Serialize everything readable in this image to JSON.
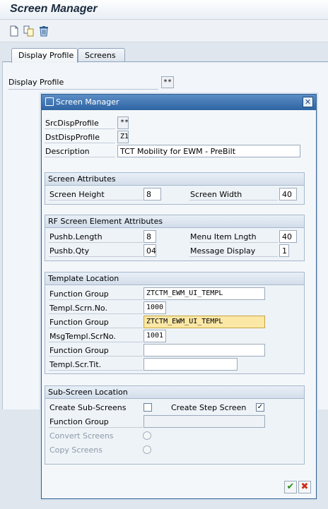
{
  "window": {
    "title": "Screen Manager"
  },
  "toolbar": {
    "icons": [
      "new-icon",
      "copy-icon",
      "delete-icon"
    ]
  },
  "tabs": [
    {
      "label": "Display Profile",
      "active": true
    },
    {
      "label": "Screens",
      "active": false
    }
  ],
  "main": {
    "display_profile_label": "Display Profile",
    "display_profile_value": "**"
  },
  "dialog": {
    "title": "Screen Manager",
    "close_label": "✕",
    "src_disp_profile": {
      "label": "SrcDispProfile",
      "value": "**"
    },
    "dst_disp_profile": {
      "label": "DstDispProfile",
      "value": "Z1"
    },
    "description": {
      "label": "Description",
      "value": "TCT Mobility for EWM - PreBilt"
    },
    "screen_attributes": {
      "title": "Screen Attributes",
      "screen_height": {
        "label": "Screen Height",
        "value": "8"
      },
      "screen_width": {
        "label": "Screen Width",
        "value": "40"
      }
    },
    "rf_attributes": {
      "title": "RF Screen Element Attributes",
      "pushb_length": {
        "label": "Pushb.Length",
        "value": "8"
      },
      "menu_item_length": {
        "label": "Menu Item Lngth",
        "value": "40"
      },
      "pushb_qty": {
        "label": "Pushb.Qty",
        "value": "04"
      },
      "message_display": {
        "label": "Message Display",
        "value": "1"
      }
    },
    "template_location": {
      "title": "Template Location",
      "function_group_1": {
        "label": "Function Group",
        "value": "ZTCTM_EWM_UI_TEMPL"
      },
      "templ_scrn_no": {
        "label": "Templ.Scrn.No.",
        "value": "1000"
      },
      "function_group_2": {
        "label": "Function Group",
        "value": "ZTCTM_EWM_UI_TEMPL"
      },
      "msg_templ_scrno": {
        "label": "MsgTempl.ScrNo.",
        "value": "1001"
      },
      "function_group_3": {
        "label": "Function Group",
        "value": ""
      },
      "templ_scr_tit": {
        "label": "Templ.Scr.Tit.",
        "value": ""
      }
    },
    "sub_screen_location": {
      "title": "Sub-Screen Location",
      "create_sub_screens": {
        "label": "Create Sub-Screens",
        "checked": false
      },
      "create_step_screen": {
        "label": "Create Step Screen",
        "checked": true,
        "mark": "✓"
      },
      "function_group": {
        "label": "Function Group",
        "value": ""
      },
      "convert_screens": {
        "label": "Convert Screens"
      },
      "copy_screens": {
        "label": "Copy Screens"
      }
    },
    "buttons": {
      "ok_label": "✔",
      "cancel_label": "✖"
    }
  }
}
